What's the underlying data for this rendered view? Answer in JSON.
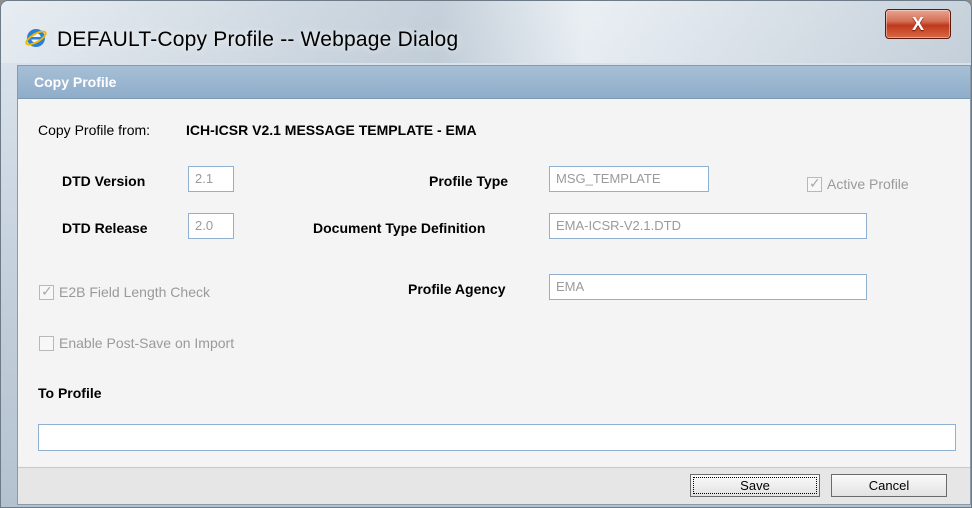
{
  "window": {
    "title": "DEFAULT-Copy Profile -- Webpage Dialog",
    "close_label": "X"
  },
  "section": {
    "title": "Copy Profile"
  },
  "copy_from": {
    "label": "Copy Profile from:",
    "value": "ICH-ICSR V2.1 MESSAGE TEMPLATE - EMA"
  },
  "fields": {
    "dtd_version": {
      "label": "DTD Version",
      "value": "2.1"
    },
    "dtd_release": {
      "label": "DTD Release",
      "value": "2.0"
    },
    "profile_type": {
      "label": "Profile Type",
      "value": "MSG_TEMPLATE"
    },
    "document_type_definition": {
      "label": "Document Type Definition",
      "value": "EMA-ICSR-V2.1.DTD"
    },
    "profile_agency": {
      "label": "Profile Agency",
      "value": "EMA"
    }
  },
  "checkboxes": {
    "active_profile": {
      "label": "Active Profile",
      "checked": true
    },
    "e2b_field_length_check": {
      "label": "E2B Field Length Check",
      "checked": true
    },
    "enable_post_save": {
      "label": "Enable Post-Save on Import",
      "checked": false
    }
  },
  "to_profile": {
    "label": "To Profile",
    "value": ""
  },
  "buttons": {
    "save": "Save",
    "cancel": "Cancel"
  },
  "colors": {
    "header_bg": "#8fadca",
    "field_border": "#8fb0cf",
    "close_button": "#c0391c"
  }
}
